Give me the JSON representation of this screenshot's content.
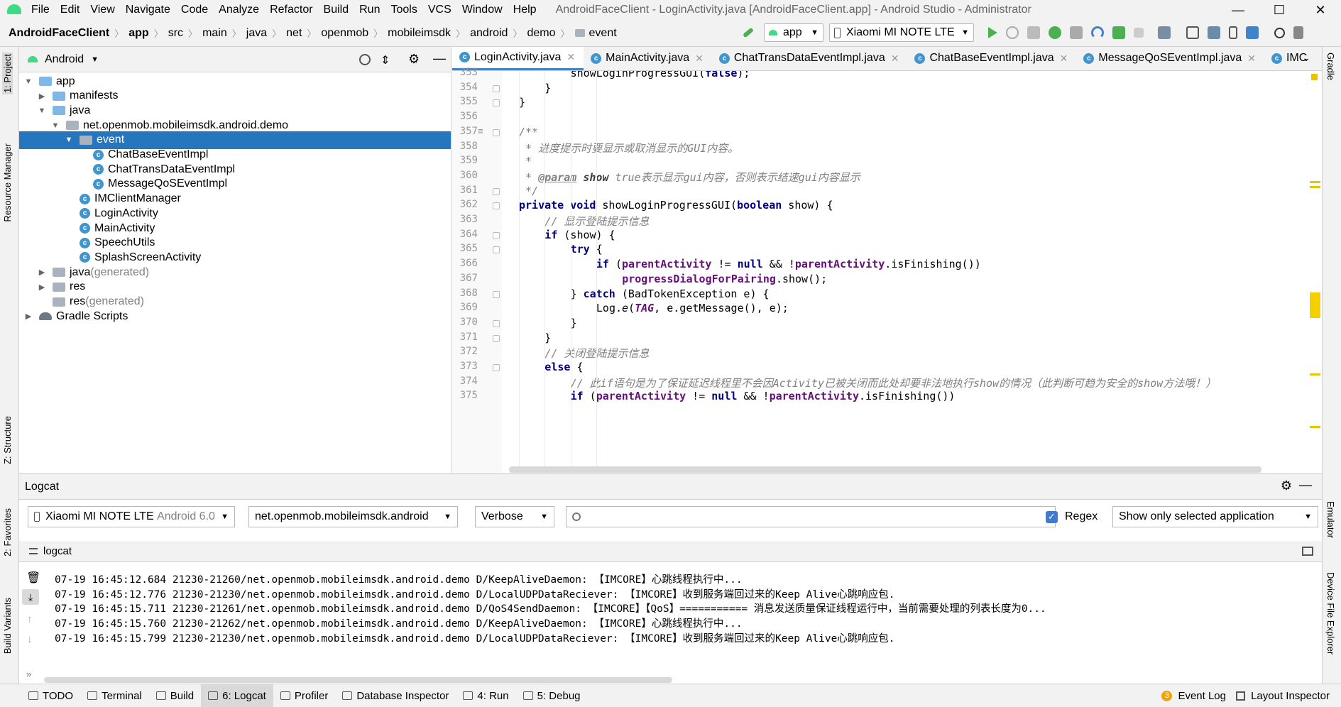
{
  "titlebar": {
    "menu": [
      "File",
      "Edit",
      "View",
      "Navigate",
      "Code",
      "Analyze",
      "Refactor",
      "Build",
      "Run",
      "Tools",
      "VCS",
      "Window",
      "Help"
    ],
    "title": "AndroidFaceClient - LoginActivity.java [AndroidFaceClient.app] - Android Studio - Administrator"
  },
  "breadcrumb": [
    "AndroidFaceClient",
    "app",
    "src",
    "main",
    "java",
    "net",
    "openmob",
    "mobileimsdk",
    "android",
    "demo",
    "event"
  ],
  "toolbar": {
    "config": "app",
    "device": "Xiaomi MI NOTE LTE"
  },
  "project": {
    "view": "Android",
    "tree": [
      {
        "label": "app",
        "indent": 0,
        "arrow": "▼",
        "icon": "folder",
        "bold": true
      },
      {
        "label": "manifests",
        "indent": 1,
        "arrow": "▶",
        "icon": "folder"
      },
      {
        "label": "java",
        "indent": 1,
        "arrow": "▼",
        "icon": "folder"
      },
      {
        "label": "net.openmob.mobileimsdk.android.demo",
        "indent": 2,
        "arrow": "▼",
        "icon": "pkg"
      },
      {
        "label": "event",
        "indent": 3,
        "arrow": "▼",
        "icon": "pkg",
        "selected": true
      },
      {
        "label": "ChatBaseEventImpl",
        "indent": 4,
        "arrow": "",
        "icon": "class"
      },
      {
        "label": "ChatTransDataEventImpl",
        "indent": 4,
        "arrow": "",
        "icon": "class"
      },
      {
        "label": "MessageQoSEventImpl",
        "indent": 4,
        "arrow": "",
        "icon": "class"
      },
      {
        "label": "IMClientManager",
        "indent": 3,
        "arrow": "",
        "icon": "class"
      },
      {
        "label": "LoginActivity",
        "indent": 3,
        "arrow": "",
        "icon": "class"
      },
      {
        "label": "MainActivity",
        "indent": 3,
        "arrow": "",
        "icon": "class"
      },
      {
        "label": "SpeechUtils",
        "indent": 3,
        "arrow": "",
        "icon": "class"
      },
      {
        "label": "SplashScreenActivity",
        "indent": 3,
        "arrow": "",
        "icon": "class"
      },
      {
        "label": "java",
        "suffix": " (generated)",
        "indent": 1,
        "arrow": "▶",
        "icon": "folder-gen"
      },
      {
        "label": "res",
        "indent": 1,
        "arrow": "▶",
        "icon": "folder-res"
      },
      {
        "label": "res",
        "suffix": " (generated)",
        "indent": 1,
        "arrow": "",
        "icon": "folder-res"
      },
      {
        "label": "Gradle Scripts",
        "indent": 0,
        "arrow": "▶",
        "icon": "gradle"
      }
    ]
  },
  "editor": {
    "tabs": [
      {
        "label": "LoginActivity.java",
        "active": true,
        "close": true
      },
      {
        "label": "MainActivity.java",
        "close": true
      },
      {
        "label": "ChatTransDataEventImpl.java",
        "close": true
      },
      {
        "label": "ChatBaseEventImpl.java",
        "close": true
      },
      {
        "label": "MessageQoSEventImpl.java",
        "close": true
      },
      {
        "label": "IMC",
        "close": false
      }
    ],
    "lines": [
      {
        "n": "353",
        "ind": 3,
        "html": "showLoginProgressGUI(<span class='kw'>false</span>);"
      },
      {
        "n": "354",
        "ind": 2,
        "html": "}"
      },
      {
        "n": "355",
        "ind": 1,
        "html": "}"
      },
      {
        "n": "356",
        "ind": 0,
        "html": ""
      },
      {
        "n": "357",
        "ind": 1,
        "html": "<span class='cm'>/**</span>"
      },
      {
        "n": "358",
        "ind": 1,
        "html": "<span class='cm'> * 进度提示时要显示或取消显示的GUI内容。</span>"
      },
      {
        "n": "359",
        "ind": 1,
        "html": "<span class='cm'> *</span>"
      },
      {
        "n": "360",
        "ind": 1,
        "html": "<span class='cm'> * </span><span class='tag'>@param</span> <span class='tagv'>show</span><span class='cm'> true表示显示gui内容，否则表示结速gui内容显示</span>"
      },
      {
        "n": "361",
        "ind": 1,
        "html": "<span class='cm'> */</span>"
      },
      {
        "n": "362",
        "ind": 1,
        "html": "<span class='kw'>private void</span> showLoginProgressGUI(<span class='kw'>boolean</span> show) {"
      },
      {
        "n": "363",
        "ind": 2,
        "html": "<span class='cm'>// 显示登陆提示信息</span>"
      },
      {
        "n": "364",
        "ind": 2,
        "html": "<span class='kw'>if</span> (show) {"
      },
      {
        "n": "365",
        "ind": 3,
        "html": "<span class='kw'>try</span> {"
      },
      {
        "n": "366",
        "ind": 4,
        "html": "<span class='kw'>if</span> (<span class='fld'>parentActivity</span> != <span class='kw'>null</span> &amp;&amp; !<span class='fld'>parentActivity</span>.isFinishing())"
      },
      {
        "n": "367",
        "ind": 5,
        "html": "<span class='fld'>progressDialogForPairing</span>.show();"
      },
      {
        "n": "368",
        "ind": 3,
        "html": "} <span class='kw'>catch</span> (BadTokenException e) {"
      },
      {
        "n": "369",
        "ind": 4,
        "html": "Log.<span class='it'>e</span>(<span class='st'>TAG</span>, e.getMessage(), e);"
      },
      {
        "n": "370",
        "ind": 3,
        "html": "}"
      },
      {
        "n": "371",
        "ind": 2,
        "html": "}"
      },
      {
        "n": "372",
        "ind": 2,
        "html": "<span class='cm'>// 关闭登陆提示信息</span>"
      },
      {
        "n": "373",
        "ind": 2,
        "html": "<span class='kw'>else</span> {"
      },
      {
        "n": "374",
        "ind": 3,
        "html": "<span class='cm'>// 此if语句是为了保证延迟线程里不会因Activity已被关闭而此处却要非法地执行show的情况（此判断可趋为安全的show方法哦！）</span>"
      },
      {
        "n": "375",
        "ind": 3,
        "html": "<span class='kw'>if</span> (<span class='fld'>parentActivity</span> != <span class='kw'>null</span> &amp;&amp; !<span class='fld'>parentActivity</span>.isFinishing())"
      }
    ]
  },
  "logcat": {
    "title": "Logcat",
    "device": "Xiaomi MI NOTE LTE",
    "device_os": "Android 6.0",
    "process": "net.openmob.mobileimsdk.android",
    "level": "Verbose",
    "search_value": "",
    "regex_label": "Regex",
    "filter": "Show only selected application",
    "sub_tab": "logcat",
    "lines": [
      "07-19 16:45:12.684 21230-21260/net.openmob.mobileimsdk.android.demo D/KeepAliveDaemon: 【IMCORE】心跳线程执行中...",
      "07-19 16:45:12.776 21230-21230/net.openmob.mobileimsdk.android.demo D/LocalUDPDataReciever: 【IMCORE】收到服务端回过来的Keep Alive心跳响应包.",
      "07-19 16:45:15.711 21230-21261/net.openmob.mobileimsdk.android.demo D/QoS4SendDaemon: 【IMCORE】【QoS】=========== 消息发送质量保证线程运行中，当前需要处理的列表长度为0...",
      "07-19 16:45:15.760 21230-21262/net.openmob.mobileimsdk.android.demo D/KeepAliveDaemon: 【IMCORE】心跳线程执行中...",
      "07-19 16:45:15.799 21230-21230/net.openmob.mobileimsdk.android.demo D/LocalUDPDataReciever: 【IMCORE】收到服务端回过来的Keep Alive心跳响应包."
    ]
  },
  "left_tabs": [
    "1: Project",
    "Resource Manager",
    "Z: Structure",
    "2: Favorites",
    "Build Variants"
  ],
  "right_tabs": [
    "Gradle",
    "Emulator",
    "Device File Explorer"
  ],
  "bottom_tabs": [
    {
      "label": "TODO"
    },
    {
      "label": "Terminal"
    },
    {
      "label": "Build"
    },
    {
      "label": "6: Logcat",
      "active": true
    },
    {
      "label": "Profiler"
    },
    {
      "label": "Database Inspector"
    },
    {
      "label": "4: Run"
    },
    {
      "label": "5: Debug"
    }
  ],
  "bottom_right": {
    "event_log": "Event Log",
    "event_count": "3",
    "layout_inspector": "Layout Inspector"
  }
}
